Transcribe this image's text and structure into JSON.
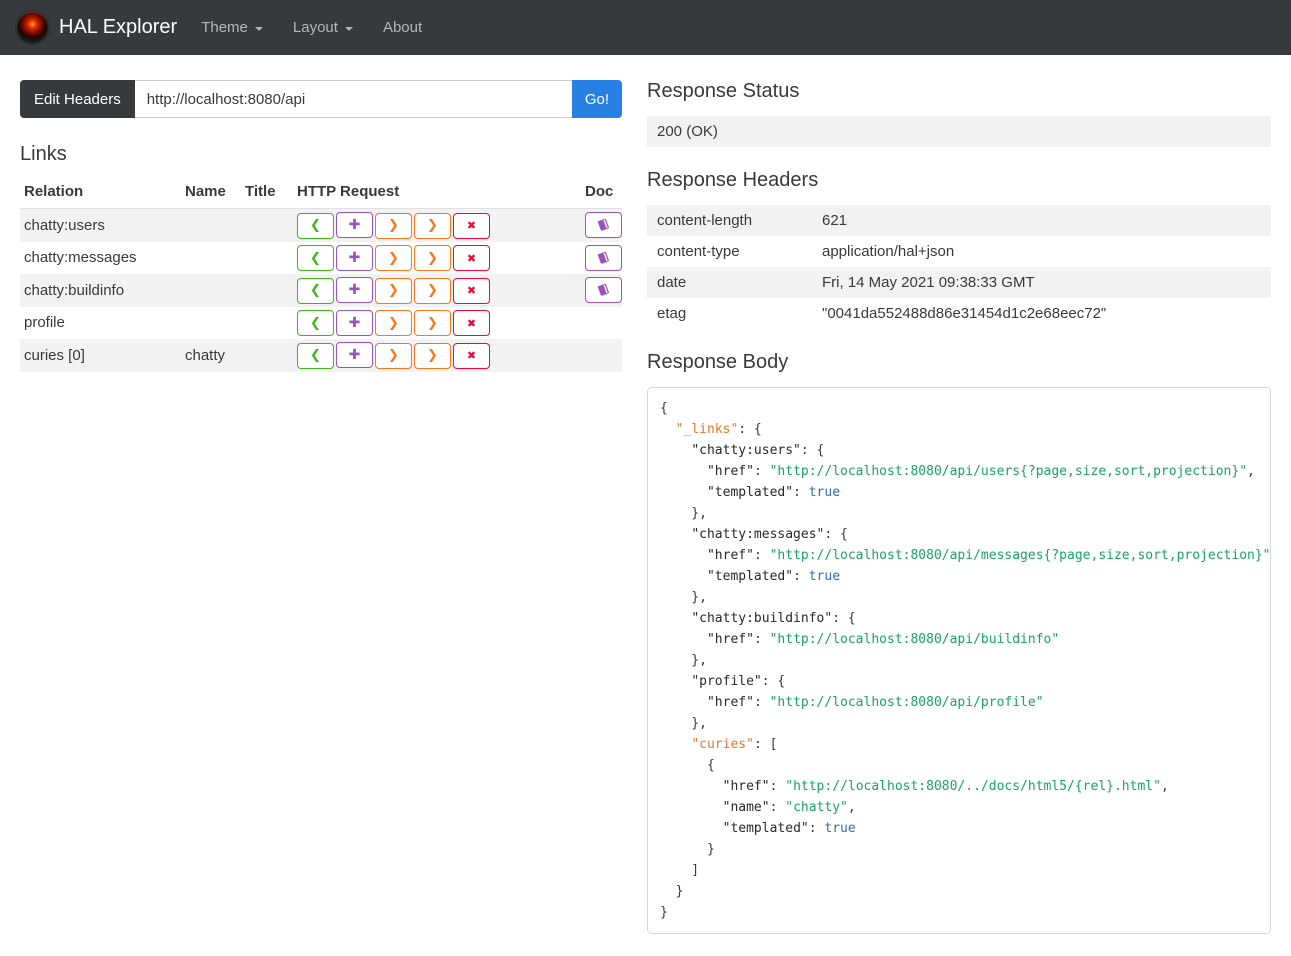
{
  "navbar": {
    "brand": "HAL Explorer",
    "items": [
      {
        "label": "Theme",
        "has_caret": true
      },
      {
        "label": "Layout",
        "has_caret": true
      },
      {
        "label": "About",
        "has_caret": false
      }
    ]
  },
  "request_bar": {
    "edit_headers_label": "Edit Headers",
    "url_value": "http://localhost:8080/api",
    "go_label": "Go!"
  },
  "links_section": {
    "title": "Links",
    "columns": [
      "Relation",
      "Name",
      "Title",
      "HTTP Request",
      "Doc"
    ],
    "http_buttons": [
      {
        "method": "get",
        "icon": "chevron-left-icon",
        "glyph": "❮",
        "color": "#3fb618"
      },
      {
        "method": "post",
        "icon": "plus-icon",
        "glyph": "✚",
        "color": "#9954bb"
      },
      {
        "method": "put",
        "icon": "chevron-right-icon",
        "glyph": "❯",
        "color": "#ff7518"
      },
      {
        "method": "patch",
        "icon": "chevron-right-icon",
        "glyph": "❯",
        "color": "#ff7518"
      },
      {
        "method": "delete",
        "icon": "x-icon",
        "glyph": "✖",
        "color": "#ff0039"
      }
    ],
    "doc_button": {
      "icon": "book-icon",
      "color": "#9954bb"
    },
    "rows": [
      {
        "relation": "chatty:users",
        "name": "",
        "title": "",
        "doc": true
      },
      {
        "relation": "chatty:messages",
        "name": "",
        "title": "",
        "doc": true
      },
      {
        "relation": "chatty:buildinfo",
        "name": "",
        "title": "",
        "doc": true
      },
      {
        "relation": "profile",
        "name": "",
        "title": "",
        "doc": false
      },
      {
        "relation": "curies [0]",
        "name": "chatty",
        "title": "",
        "doc": false
      }
    ]
  },
  "response_status": {
    "title": "Response Status",
    "value": "200 (OK)"
  },
  "response_headers": {
    "title": "Response Headers",
    "rows": [
      {
        "name": "content-length",
        "value": "621"
      },
      {
        "name": "content-type",
        "value": "application/hal+json"
      },
      {
        "name": "date",
        "value": "Fri, 14 May 2021 09:38:33 GMT"
      },
      {
        "name": "etag",
        "value": "\"0041da552488d86e31454d1c2e68eec72\""
      }
    ]
  },
  "response_body": {
    "title": "Response Body",
    "token_colors": {
      "p": "#373a3c",
      "k": "#24292e",
      "x": "#e6772e",
      "s": "#18a465",
      "b": "#2d6fb2"
    },
    "lines": [
      [
        {
          "t": "{",
          "c": "p"
        }
      ],
      [
        {
          "t": "  ",
          "c": "p"
        },
        {
          "t": "\"_links\"",
          "c": "x"
        },
        {
          "t": ": {",
          "c": "p"
        }
      ],
      [
        {
          "t": "    ",
          "c": "p"
        },
        {
          "t": "\"chatty:users\"",
          "c": "k"
        },
        {
          "t": ": {",
          "c": "p"
        }
      ],
      [
        {
          "t": "      ",
          "c": "p"
        },
        {
          "t": "\"href\"",
          "c": "k"
        },
        {
          "t": ": ",
          "c": "p"
        },
        {
          "t": "\"http://localhost:8080/api/users{?page,size,sort,projection}\"",
          "c": "s"
        },
        {
          "t": ",",
          "c": "p"
        }
      ],
      [
        {
          "t": "      ",
          "c": "p"
        },
        {
          "t": "\"templated\"",
          "c": "k"
        },
        {
          "t": ": ",
          "c": "p"
        },
        {
          "t": "true",
          "c": "b"
        }
      ],
      [
        {
          "t": "    },",
          "c": "p"
        }
      ],
      [
        {
          "t": "    ",
          "c": "p"
        },
        {
          "t": "\"chatty:messages\"",
          "c": "k"
        },
        {
          "t": ": {",
          "c": "p"
        }
      ],
      [
        {
          "t": "      ",
          "c": "p"
        },
        {
          "t": "\"href\"",
          "c": "k"
        },
        {
          "t": ": ",
          "c": "p"
        },
        {
          "t": "\"http://localhost:8080/api/messages{?page,size,sort,projection}\"",
          "c": "s"
        },
        {
          "t": ",",
          "c": "p"
        }
      ],
      [
        {
          "t": "      ",
          "c": "p"
        },
        {
          "t": "\"templated\"",
          "c": "k"
        },
        {
          "t": ": ",
          "c": "p"
        },
        {
          "t": "true",
          "c": "b"
        }
      ],
      [
        {
          "t": "    },",
          "c": "p"
        }
      ],
      [
        {
          "t": "    ",
          "c": "p"
        },
        {
          "t": "\"chatty:buildinfo\"",
          "c": "k"
        },
        {
          "t": ": {",
          "c": "p"
        }
      ],
      [
        {
          "t": "      ",
          "c": "p"
        },
        {
          "t": "\"href\"",
          "c": "k"
        },
        {
          "t": ": ",
          "c": "p"
        },
        {
          "t": "\"http://localhost:8080/api/buildinfo\"",
          "c": "s"
        }
      ],
      [
        {
          "t": "    },",
          "c": "p"
        }
      ],
      [
        {
          "t": "    ",
          "c": "p"
        },
        {
          "t": "\"profile\"",
          "c": "k"
        },
        {
          "t": ": {",
          "c": "p"
        }
      ],
      [
        {
          "t": "      ",
          "c": "p"
        },
        {
          "t": "\"href\"",
          "c": "k"
        },
        {
          "t": ": ",
          "c": "p"
        },
        {
          "t": "\"http://localhost:8080/api/profile\"",
          "c": "s"
        }
      ],
      [
        {
          "t": "    },",
          "c": "p"
        }
      ],
      [
        {
          "t": "    ",
          "c": "p"
        },
        {
          "t": "\"curies\"",
          "c": "x"
        },
        {
          "t": ": [",
          "c": "p"
        }
      ],
      [
        {
          "t": "      {",
          "c": "p"
        }
      ],
      [
        {
          "t": "        ",
          "c": "p"
        },
        {
          "t": "\"href\"",
          "c": "k"
        },
        {
          "t": ": ",
          "c": "p"
        },
        {
          "t": "\"http://localhost:8080/../docs/html5/{rel}.html\"",
          "c": "s"
        },
        {
          "t": ",",
          "c": "p"
        }
      ],
      [
        {
          "t": "        ",
          "c": "p"
        },
        {
          "t": "\"name\"",
          "c": "k"
        },
        {
          "t": ": ",
          "c": "p"
        },
        {
          "t": "\"chatty\"",
          "c": "s"
        },
        {
          "t": ",",
          "c": "p"
        }
      ],
      [
        {
          "t": "        ",
          "c": "p"
        },
        {
          "t": "\"templated\"",
          "c": "k"
        },
        {
          "t": ": ",
          "c": "p"
        },
        {
          "t": "true",
          "c": "b"
        }
      ],
      [
        {
          "t": "      }",
          "c": "p"
        }
      ],
      [
        {
          "t": "    ]",
          "c": "p"
        }
      ],
      [
        {
          "t": "  }",
          "c": "p"
        }
      ],
      [
        {
          "t": "}",
          "c": "p"
        }
      ]
    ]
  },
  "colors": {
    "navbar_bg": "#373a3c",
    "primary_blue": "#2780e3",
    "stripe_gray": "#f2f2f2",
    "get_green": "#3fb618",
    "post_purple": "#9954bb",
    "put_patch_orange": "#ff7518",
    "delete_red": "#ff0039"
  }
}
